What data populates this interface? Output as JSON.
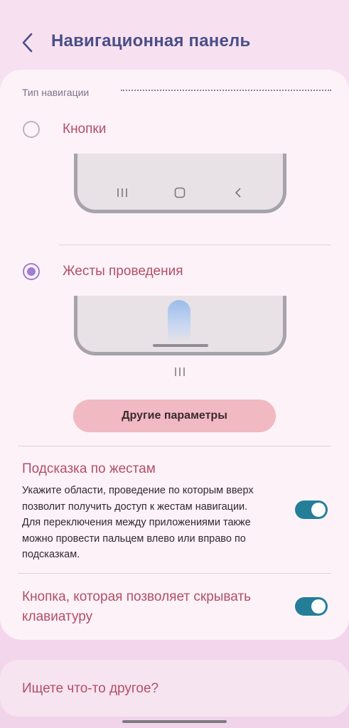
{
  "header": {
    "title": "Навигационная панель",
    "back_icon": "chevron-left-icon"
  },
  "navigation_type": {
    "section_label": "Тип навигации",
    "options": [
      {
        "label": "Кнопки",
        "selected": false
      },
      {
        "label": "Жесты проведения",
        "selected": true
      }
    ],
    "buttons_preview_icons": [
      "recents-icon",
      "home-icon",
      "back-icon"
    ],
    "gesture_sub_icon": "recents-icon"
  },
  "other_params_button": "Другие параметры",
  "gesture_hint": {
    "title": "Подсказка по жестам",
    "description": "Укажите области, проведение по которым вверх позволит получить доступ к жестам навигации. Для переключения между приложениями также можно провести пальцем влево или вправо по подсказкам.",
    "enabled": true
  },
  "hide_keyboard": {
    "title": "Кнопка, которая позволяет скрывать клавиатуру",
    "enabled": true
  },
  "search": {
    "text": "Ищете что-то другое?"
  },
  "colors": {
    "accent": "#247e98",
    "radio": "#9e7cd8",
    "label": "#b34f66",
    "title": "#4a4f86"
  }
}
